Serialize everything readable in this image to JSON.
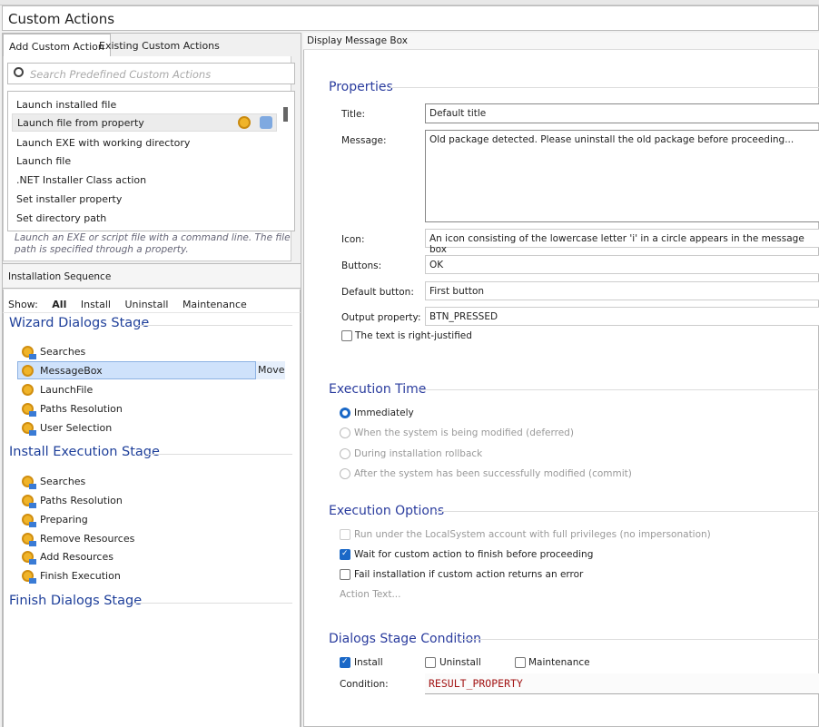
{
  "header": {
    "title": "Custom Actions"
  },
  "left": {
    "tabs": [
      {
        "label": "Add Custom Action",
        "active": true
      },
      {
        "label": "Existing Custom Actions",
        "active": false
      }
    ],
    "search": {
      "placeholder": "Search Predefined Custom Actions",
      "value": ""
    },
    "actions": [
      "Launch installed file",
      "Launch file from property",
      "Launch EXE with working directory",
      "Launch file",
      ".NET Installer Class action",
      "Set installer property",
      "Set directory path"
    ],
    "selected_action": "Launch file from property",
    "description": "Launch an EXE or script file with a command line. The file path is specified through a property.",
    "sequence": {
      "title": "Installation Sequence",
      "show_label": "Show:",
      "filters": [
        "All",
        "Install",
        "Uninstall",
        "Maintenance"
      ],
      "active_filter": "All",
      "move_label": "Move",
      "stages": [
        {
          "name": "Wizard Dialogs Stage",
          "items": [
            "Searches",
            "MessageBox",
            "LaunchFile",
            "Paths Resolution",
            "User Selection"
          ]
        },
        {
          "name": "Install Execution Stage",
          "items": [
            "Searches",
            "Paths Resolution",
            "Preparing",
            "Remove Resources",
            "Add Resources",
            "Finish Execution"
          ]
        },
        {
          "name": "Finish Dialogs Stage",
          "items": []
        }
      ]
    }
  },
  "right": {
    "title": "Display Message Box",
    "properties": {
      "heading": "Properties",
      "title_label": "Title:",
      "title_value": "Default title",
      "message_label": "Message:",
      "message_value": "Old package detected. Please uninstall the old package before proceeding...",
      "icon_label": "Icon:",
      "icon_value": "An icon consisting of the lowercase letter 'i' in a circle appears in the message box",
      "buttons_label": "Buttons:",
      "buttons_value": "OK",
      "default_button_label": "Default button:",
      "default_button_value": "First button",
      "output_label": "Output property:",
      "output_value": "BTN_PRESSED",
      "right_justified_label": "The text is right-justified",
      "right_justified": false
    },
    "execution_time": {
      "heading": "Execution Time",
      "options": [
        "Immediately",
        "When the system is being modified (deferred)",
        "During installation rollback",
        "After the system has been successfully modified (commit)"
      ],
      "selected": "Immediately"
    },
    "execution_options": {
      "heading": "Execution Options",
      "localsystem": "Run under the LocalSystem account with full privileges (no impersonation)",
      "wait": "Wait for custom action to finish before proceeding",
      "fail": "Fail installation if custom action returns an error",
      "wait_checked": true,
      "fail_checked": false,
      "localsystem_checked": false,
      "action_text": "Action Text..."
    },
    "dialogs_condition": {
      "heading": "Dialogs Stage Condition",
      "install": "Install",
      "uninstall": "Uninstall",
      "maintenance": "Maintenance",
      "install_checked": true,
      "uninstall_checked": false,
      "maintenance_checked": false,
      "condition_label": "Condition:",
      "condition_value": "RESULT_PROPERTY"
    }
  },
  "colors": {
    "accent": "#1a68c7",
    "heading": "#2a3c9e",
    "condition": "#a31515"
  }
}
